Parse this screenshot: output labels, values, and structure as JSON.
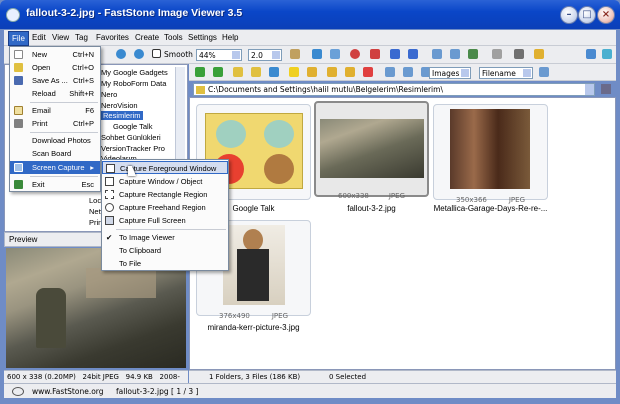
{
  "window": {
    "title": "fallout-3-2.jpg - FastStone Image Viewer 3.5"
  },
  "menubar": [
    "File",
    "Edit",
    "View",
    "Tag",
    "Favorites",
    "Create",
    "Tools",
    "Settings",
    "Help"
  ],
  "toolbar": {
    "smooth_label": "Smooth",
    "zoom_value": "44%",
    "ratio_value": "2.0"
  },
  "tree": [
    "My Google Gadgets",
    "My RoboForm Data",
    "Nero",
    "NeroVision",
    "Resimlerim",
    "Google Talk",
    "Sohbet Günlükleri",
    "VersionTracker Pro",
    "Videolarım",
    "Loca",
    "Netw",
    "Print"
  ],
  "tree_selected": "Resimlerim",
  "file_menu": [
    {
      "label": "New",
      "shortcut": "Ctrl+N",
      "icon": "new-icon"
    },
    {
      "label": "Open",
      "shortcut": "Ctrl+O",
      "icon": "open-icon"
    },
    {
      "label": "Save As ...",
      "shortcut": "Ctrl+S",
      "icon": "save-icon"
    },
    {
      "label": "Reload",
      "shortcut": "Shift+R",
      "icon": ""
    },
    {
      "label": "Email",
      "shortcut": "F6",
      "icon": "email-icon"
    },
    {
      "label": "Print",
      "shortcut": "Ctrl+P",
      "icon": "print-icon"
    },
    {
      "label": "Download Photos",
      "shortcut": "",
      "icon": ""
    },
    {
      "label": "Scan Board",
      "shortcut": "",
      "icon": ""
    },
    {
      "label": "Screen Capture",
      "shortcut": "",
      "icon": "capture-icon"
    },
    {
      "label": "Exit",
      "shortcut": "Esc",
      "icon": "exit-icon"
    }
  ],
  "capture_menu": [
    {
      "label": "Capture Foreground Window"
    },
    {
      "label": "Capture Window / Object"
    },
    {
      "label": "Capture Rectangle Region"
    },
    {
      "label": "Capture Freehand Region"
    },
    {
      "label": "Capture Full Screen"
    },
    {
      "label": "To Image Viewer"
    },
    {
      "label": "To Clipboard"
    },
    {
      "label": "To File"
    }
  ],
  "preview": {
    "label": "Preview"
  },
  "status_left": {
    "dims": "600 x 338 (0.20MP)",
    "depth": "24bit JPEG",
    "size": "94.9 KB",
    "date": "2008-"
  },
  "right_toolbar": {
    "filter_value": "Images",
    "sort_value": "Filename"
  },
  "path": "C:\\Documents and Settings\\halil mutlu\\Belgelerim\\Resimlerim\\",
  "thumbnails": [
    {
      "name": "Google Talk",
      "dims": "",
      "format": ""
    },
    {
      "name": "fallout-3-2.jpg",
      "dims": "600x338",
      "format": "JPEG"
    },
    {
      "name": "Metallica-Garage-Days-Re-re-...",
      "dims": "350x366",
      "format": "JPEG"
    },
    {
      "name": "miranda-kerr-picture-3.jpg",
      "dims": "376x490",
      "format": "JPEG"
    }
  ],
  "status_right": {
    "counts": "1 Folders, 3 Files (186 KB)",
    "selected": "0 Selected"
  },
  "bottom": {
    "website": "www.FastStone.org",
    "file": "fallout-3-2.jpg [ 1 / 3 ]"
  }
}
